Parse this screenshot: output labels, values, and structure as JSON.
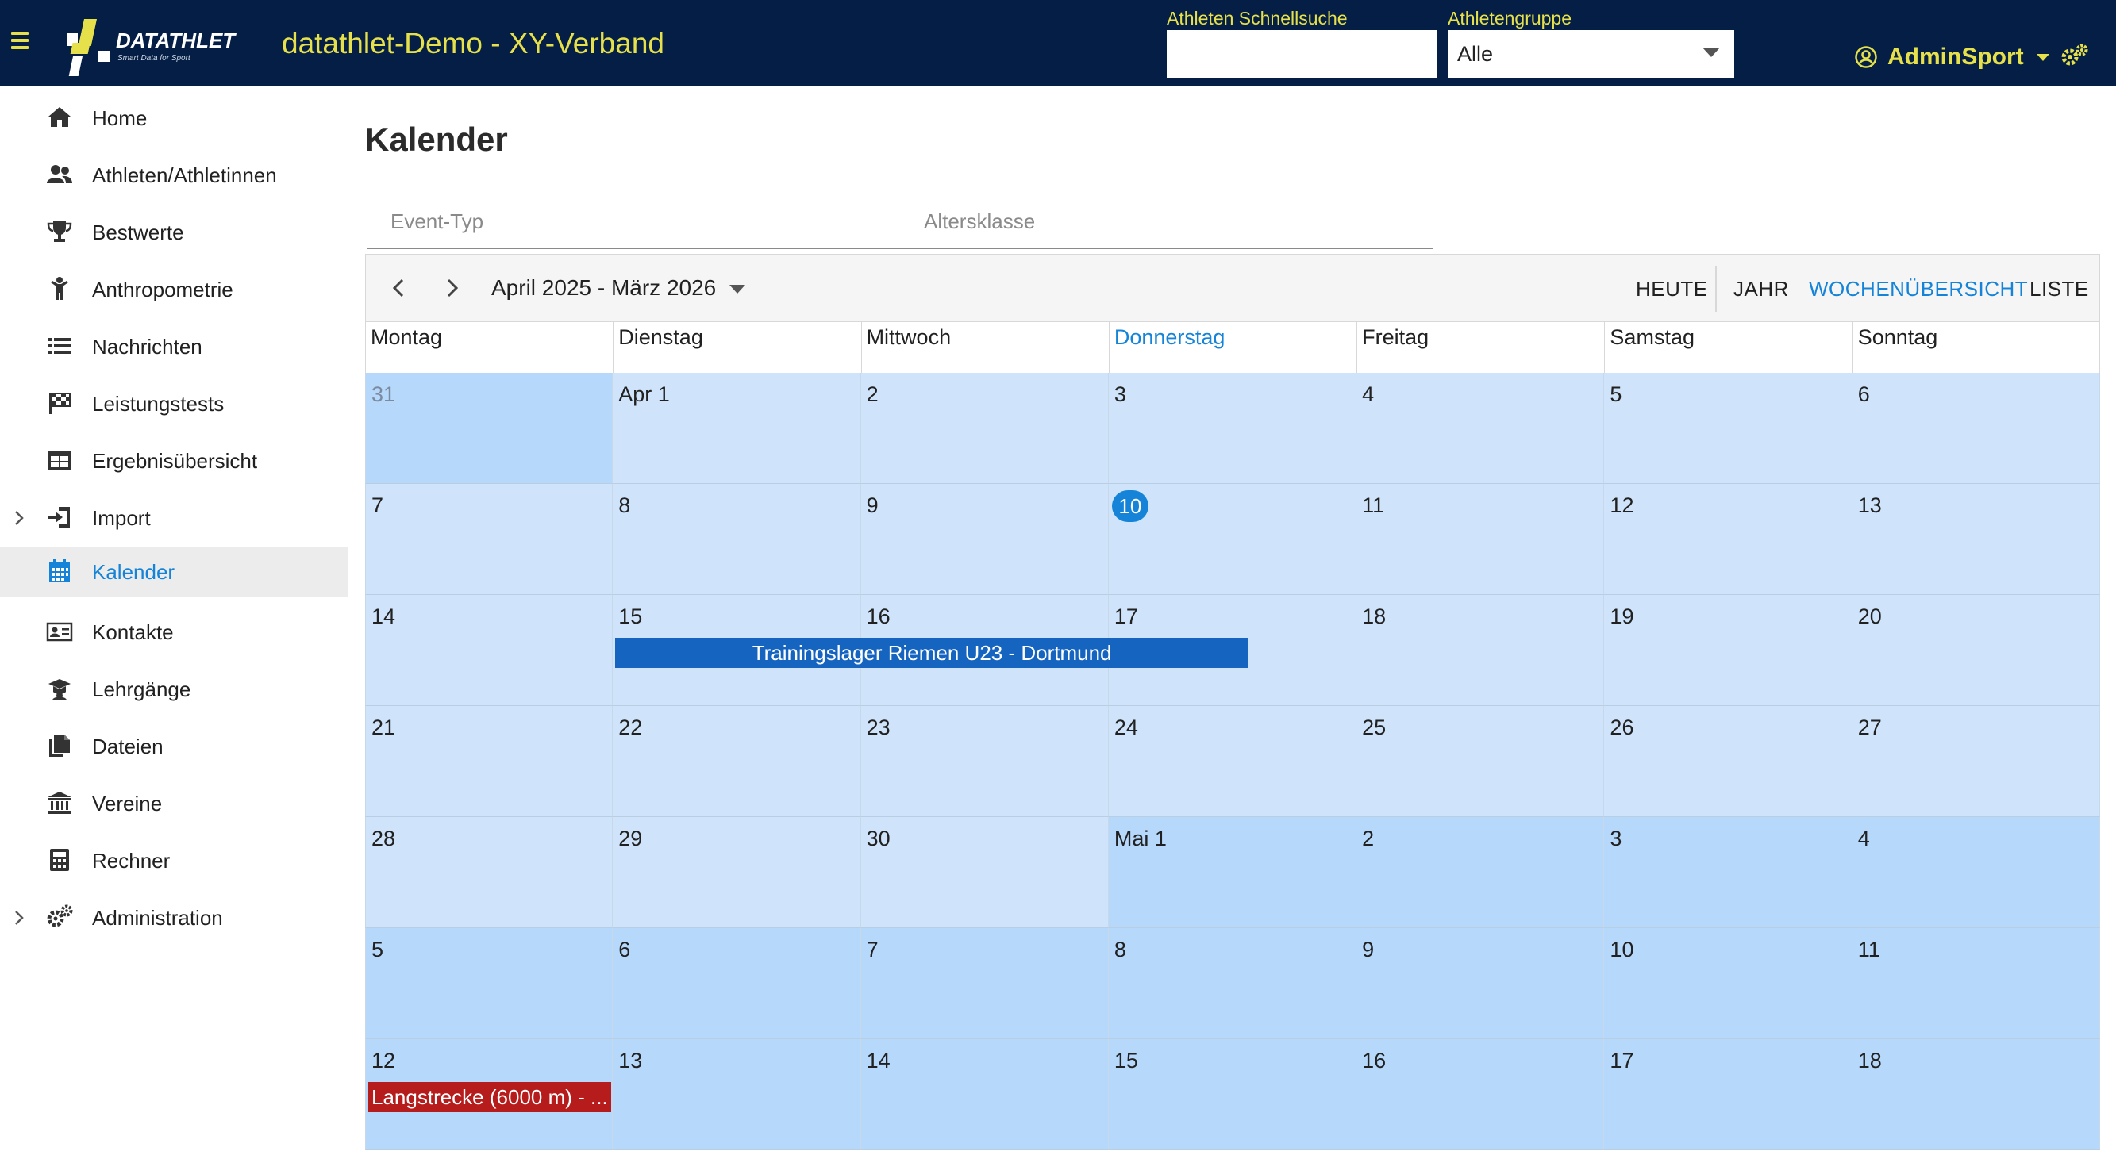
{
  "header": {
    "title": "datathlet-Demo - XY-Verband",
    "logo_text": "DATATHLET",
    "logo_tagline": "Smart Data for Sport",
    "quick_search_label": "Athleten Schnellsuche",
    "quick_search_value": "",
    "group_label": "Athletengruppe",
    "group_value": "Alle",
    "user_name": "AdminSport"
  },
  "sidebar": {
    "items": [
      {
        "label": "Home",
        "icon": "home-icon"
      },
      {
        "label": "Athleten/Athletinnen",
        "icon": "users-icon"
      },
      {
        "label": "Bestwerte",
        "icon": "trophy-icon"
      },
      {
        "label": "Anthropometrie",
        "icon": "child-icon"
      },
      {
        "label": "Nachrichten",
        "icon": "list-icon"
      },
      {
        "label": "Leistungstests",
        "icon": "checkered-flag-icon"
      },
      {
        "label": "Ergebnisübersicht",
        "icon": "table-icon"
      },
      {
        "label": "Import",
        "icon": "import-icon"
      },
      {
        "label": "Kalender",
        "icon": "calendar-icon"
      },
      {
        "label": "Kontakte",
        "icon": "contact-card-icon"
      },
      {
        "label": "Lehrgänge",
        "icon": "graduation-cap-icon"
      },
      {
        "label": "Dateien",
        "icon": "files-icon"
      },
      {
        "label": "Vereine",
        "icon": "bank-icon"
      },
      {
        "label": "Rechner",
        "icon": "calculator-icon"
      },
      {
        "label": "Administration",
        "icon": "gears-icon"
      }
    ]
  },
  "main": {
    "title": "Kalender",
    "filters": {
      "event_type_placeholder": "Event-Typ",
      "age_class_placeholder": "Altersklasse"
    },
    "toolbar": {
      "range": "April 2025 - März 2026",
      "today": "HEUTE",
      "year": "JAHR",
      "week_overview": "WOCHENÜBERSICHT",
      "list": "LISTE"
    },
    "weekdays": [
      "Montag",
      "Dienstag",
      "Mittwoch",
      "Donnerstag",
      "Freitag",
      "Samstag",
      "Sonntag"
    ],
    "weeks": [
      [
        "31",
        "Apr 1",
        "2",
        "3",
        "4",
        "5",
        "6"
      ],
      [
        "7",
        "8",
        "9",
        "10",
        "11",
        "12",
        "13"
      ],
      [
        "14",
        "15",
        "16",
        "17",
        "18",
        "19",
        "20"
      ],
      [
        "21",
        "22",
        "23",
        "24",
        "25",
        "26",
        "27"
      ],
      [
        "28",
        "29",
        "30",
        "Mai 1",
        "2",
        "3",
        "4"
      ],
      [
        "5",
        "6",
        "7",
        "8",
        "9",
        "10",
        "11"
      ],
      [
        "12",
        "13",
        "14",
        "15",
        "16",
        "17",
        "18"
      ]
    ],
    "events": [
      {
        "title": "Trainingslager Riemen U23 - Dortmund",
        "color": "#1565c0"
      },
      {
        "title": "Langstrecke (6000 m) - ...",
        "color": "#b71c1c"
      }
    ]
  },
  "colors": {
    "header_bg": "#051e45",
    "header_accent": "#e6e14a",
    "link_blue": "#1584d8",
    "april_day_bg": "#cfe4fb",
    "may_day_bg": "#b6d8fb"
  }
}
